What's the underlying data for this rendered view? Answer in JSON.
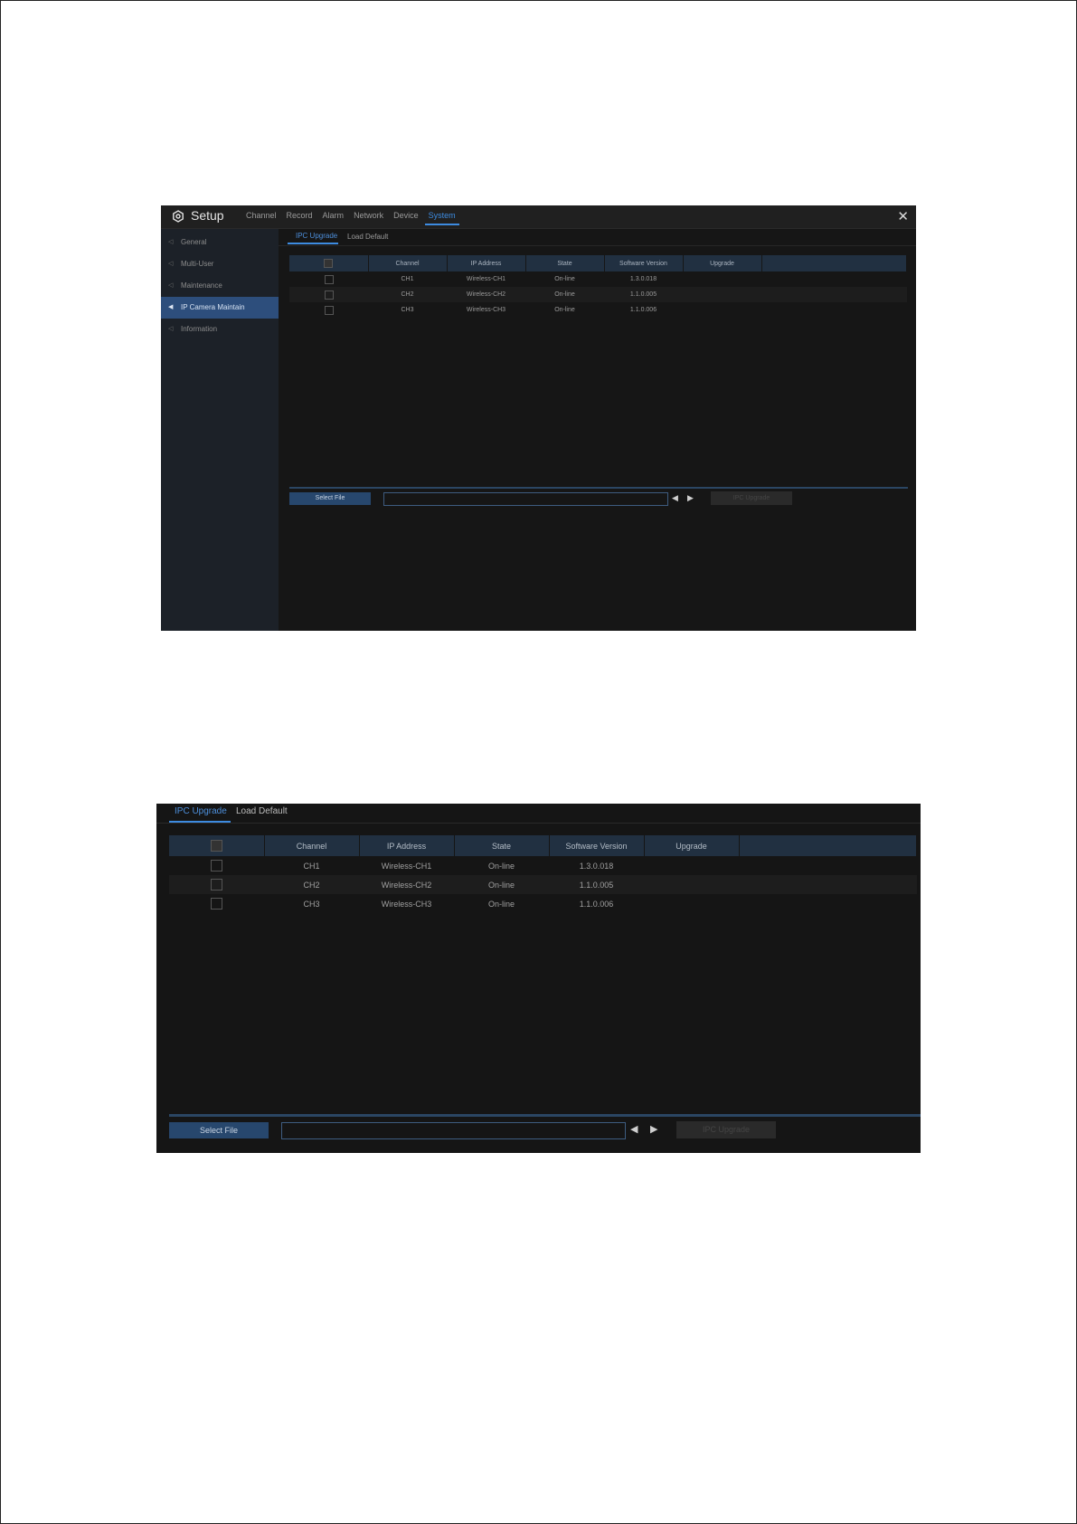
{
  "setup": {
    "title": "Setup",
    "menu": [
      "Channel",
      "Record",
      "Alarm",
      "Network",
      "Device",
      "System"
    ],
    "active_menu": "System",
    "close_glyph": "✕",
    "sidebar": [
      {
        "label": "General",
        "active": false
      },
      {
        "label": "Multi-User",
        "active": false
      },
      {
        "label": "Maintenance",
        "active": false
      },
      {
        "label": "IP Camera Maintain",
        "active": true
      },
      {
        "label": "Information",
        "active": false
      }
    ]
  },
  "tabs": {
    "ipc_upgrade": "IPC Upgrade",
    "load_default": "Load Default"
  },
  "table": {
    "headers": [
      "",
      "Channel",
      "IP Address",
      "State",
      "Software Version",
      "Upgrade",
      ""
    ],
    "rows": [
      {
        "channel": "CH1",
        "ip": "Wireless-CH1",
        "state": "On-line",
        "version": "1.3.0.018",
        "upgrade": ""
      },
      {
        "channel": "CH2",
        "ip": "Wireless-CH2",
        "state": "On-line",
        "version": "1.1.0.005",
        "upgrade": ""
      },
      {
        "channel": "CH3",
        "ip": "Wireless-CH3",
        "state": "On-line",
        "version": "1.1.0.006",
        "upgrade": ""
      }
    ]
  },
  "footer": {
    "select_file": "Select File",
    "file_value": "",
    "prev_glyph": "◀",
    "next_glyph": "▶",
    "upgrade_button": "IPC Upgrade"
  },
  "colors": {
    "accent": "#3d8be0",
    "header_bg": "#213041",
    "button_bg": "#27476d",
    "window_bg": "#161616"
  }
}
